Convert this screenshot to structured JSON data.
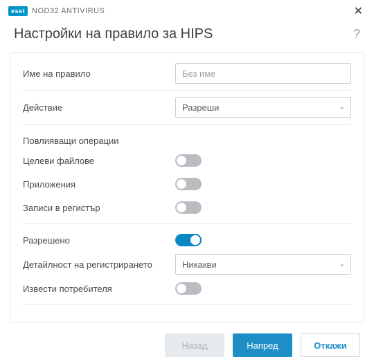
{
  "titlebar": {
    "brand_badge": "eset",
    "brand_text": "NOD32 ANTIVIRUS"
  },
  "heading": "Настройки на правило за HIPS",
  "rule_name": {
    "label": "Име на правило",
    "placeholder": "Без име",
    "value": ""
  },
  "action": {
    "label": "Действие",
    "value": "Разреши"
  },
  "operations": {
    "section_label": "Повлияващи операции",
    "target_files": {
      "label": "Целеви файлове",
      "on": false
    },
    "applications": {
      "label": "Приложения",
      "on": false
    },
    "registry": {
      "label": "Записи в регистър",
      "on": false
    }
  },
  "enabled": {
    "label": "Разрешено",
    "on": true
  },
  "log_detail": {
    "label": "Детайлност на регистрирането",
    "value": "Никакви"
  },
  "notify": {
    "label": "Извести потребителя",
    "on": false
  },
  "footer": {
    "back": "Назад",
    "next": "Напред",
    "cancel": "Откажи"
  }
}
